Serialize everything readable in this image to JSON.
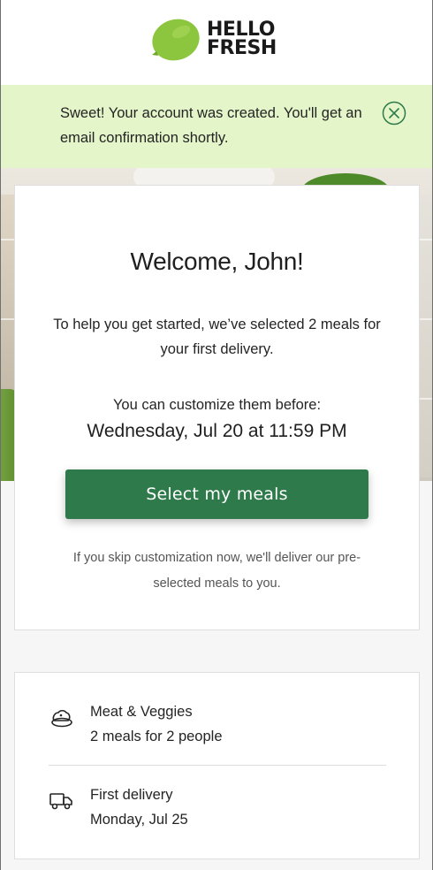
{
  "brand": {
    "line1": "HELLO",
    "line2": "FRESH",
    "lime_color": "#8cc63f",
    "icon": "lime-icon"
  },
  "banner": {
    "message": "Sweet! Your account was created. You'll get an email confirmation shortly.",
    "close_icon": "close-circle-icon",
    "background": "#e4f5c9"
  },
  "welcome": {
    "title": "Welcome, John!",
    "intro": "To help you get started, we’ve selected 2 meals for your first delivery.",
    "customize_label": "You can customize them before:",
    "deadline": "Wednesday, Jul 20 at 11:59 PM",
    "cta_label": "Select my meals",
    "cta_color": "#2f7a4a",
    "skip_note": "If you skip customization now, we'll deliver our pre-selected meals to you."
  },
  "summary": {
    "plan": {
      "icon": "meal-plan-icon",
      "title": "Meat & Veggies",
      "detail": "2 meals for 2 people"
    },
    "delivery": {
      "icon": "delivery-truck-icon",
      "title": "First delivery",
      "detail": "Monday, Jul 25"
    }
  }
}
